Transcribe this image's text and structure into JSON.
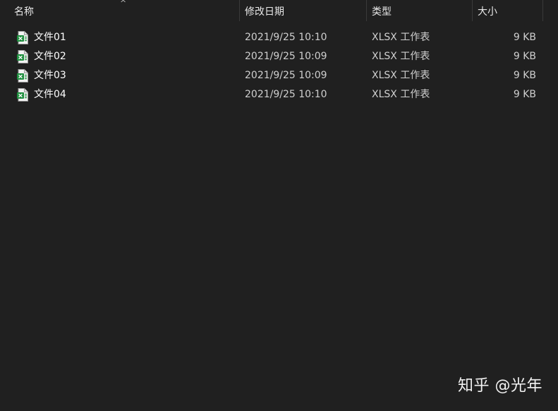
{
  "columns": {
    "name": "名称",
    "date": "修改日期",
    "type": "类型",
    "size": "大小"
  },
  "sort_indicator": "^",
  "files": [
    {
      "name": "文件01",
      "date": "2021/9/25 10:10",
      "type": "XLSX 工作表",
      "size": "9 KB",
      "icon": "xlsx-file-icon"
    },
    {
      "name": "文件02",
      "date": "2021/9/25 10:09",
      "type": "XLSX 工作表",
      "size": "9 KB",
      "icon": "xlsx-file-icon"
    },
    {
      "name": "文件03",
      "date": "2021/9/25 10:09",
      "type": "XLSX 工作表",
      "size": "9 KB",
      "icon": "xlsx-file-icon"
    },
    {
      "name": "文件04",
      "date": "2021/9/25 10:10",
      "type": "XLSX 工作表",
      "size": "9 KB",
      "icon": "xlsx-file-icon"
    }
  ],
  "watermark": "知乎 @光年",
  "colors": {
    "background": "#202020",
    "separator": "#3a3a3a",
    "icon_green": "#1e8e3e"
  }
}
